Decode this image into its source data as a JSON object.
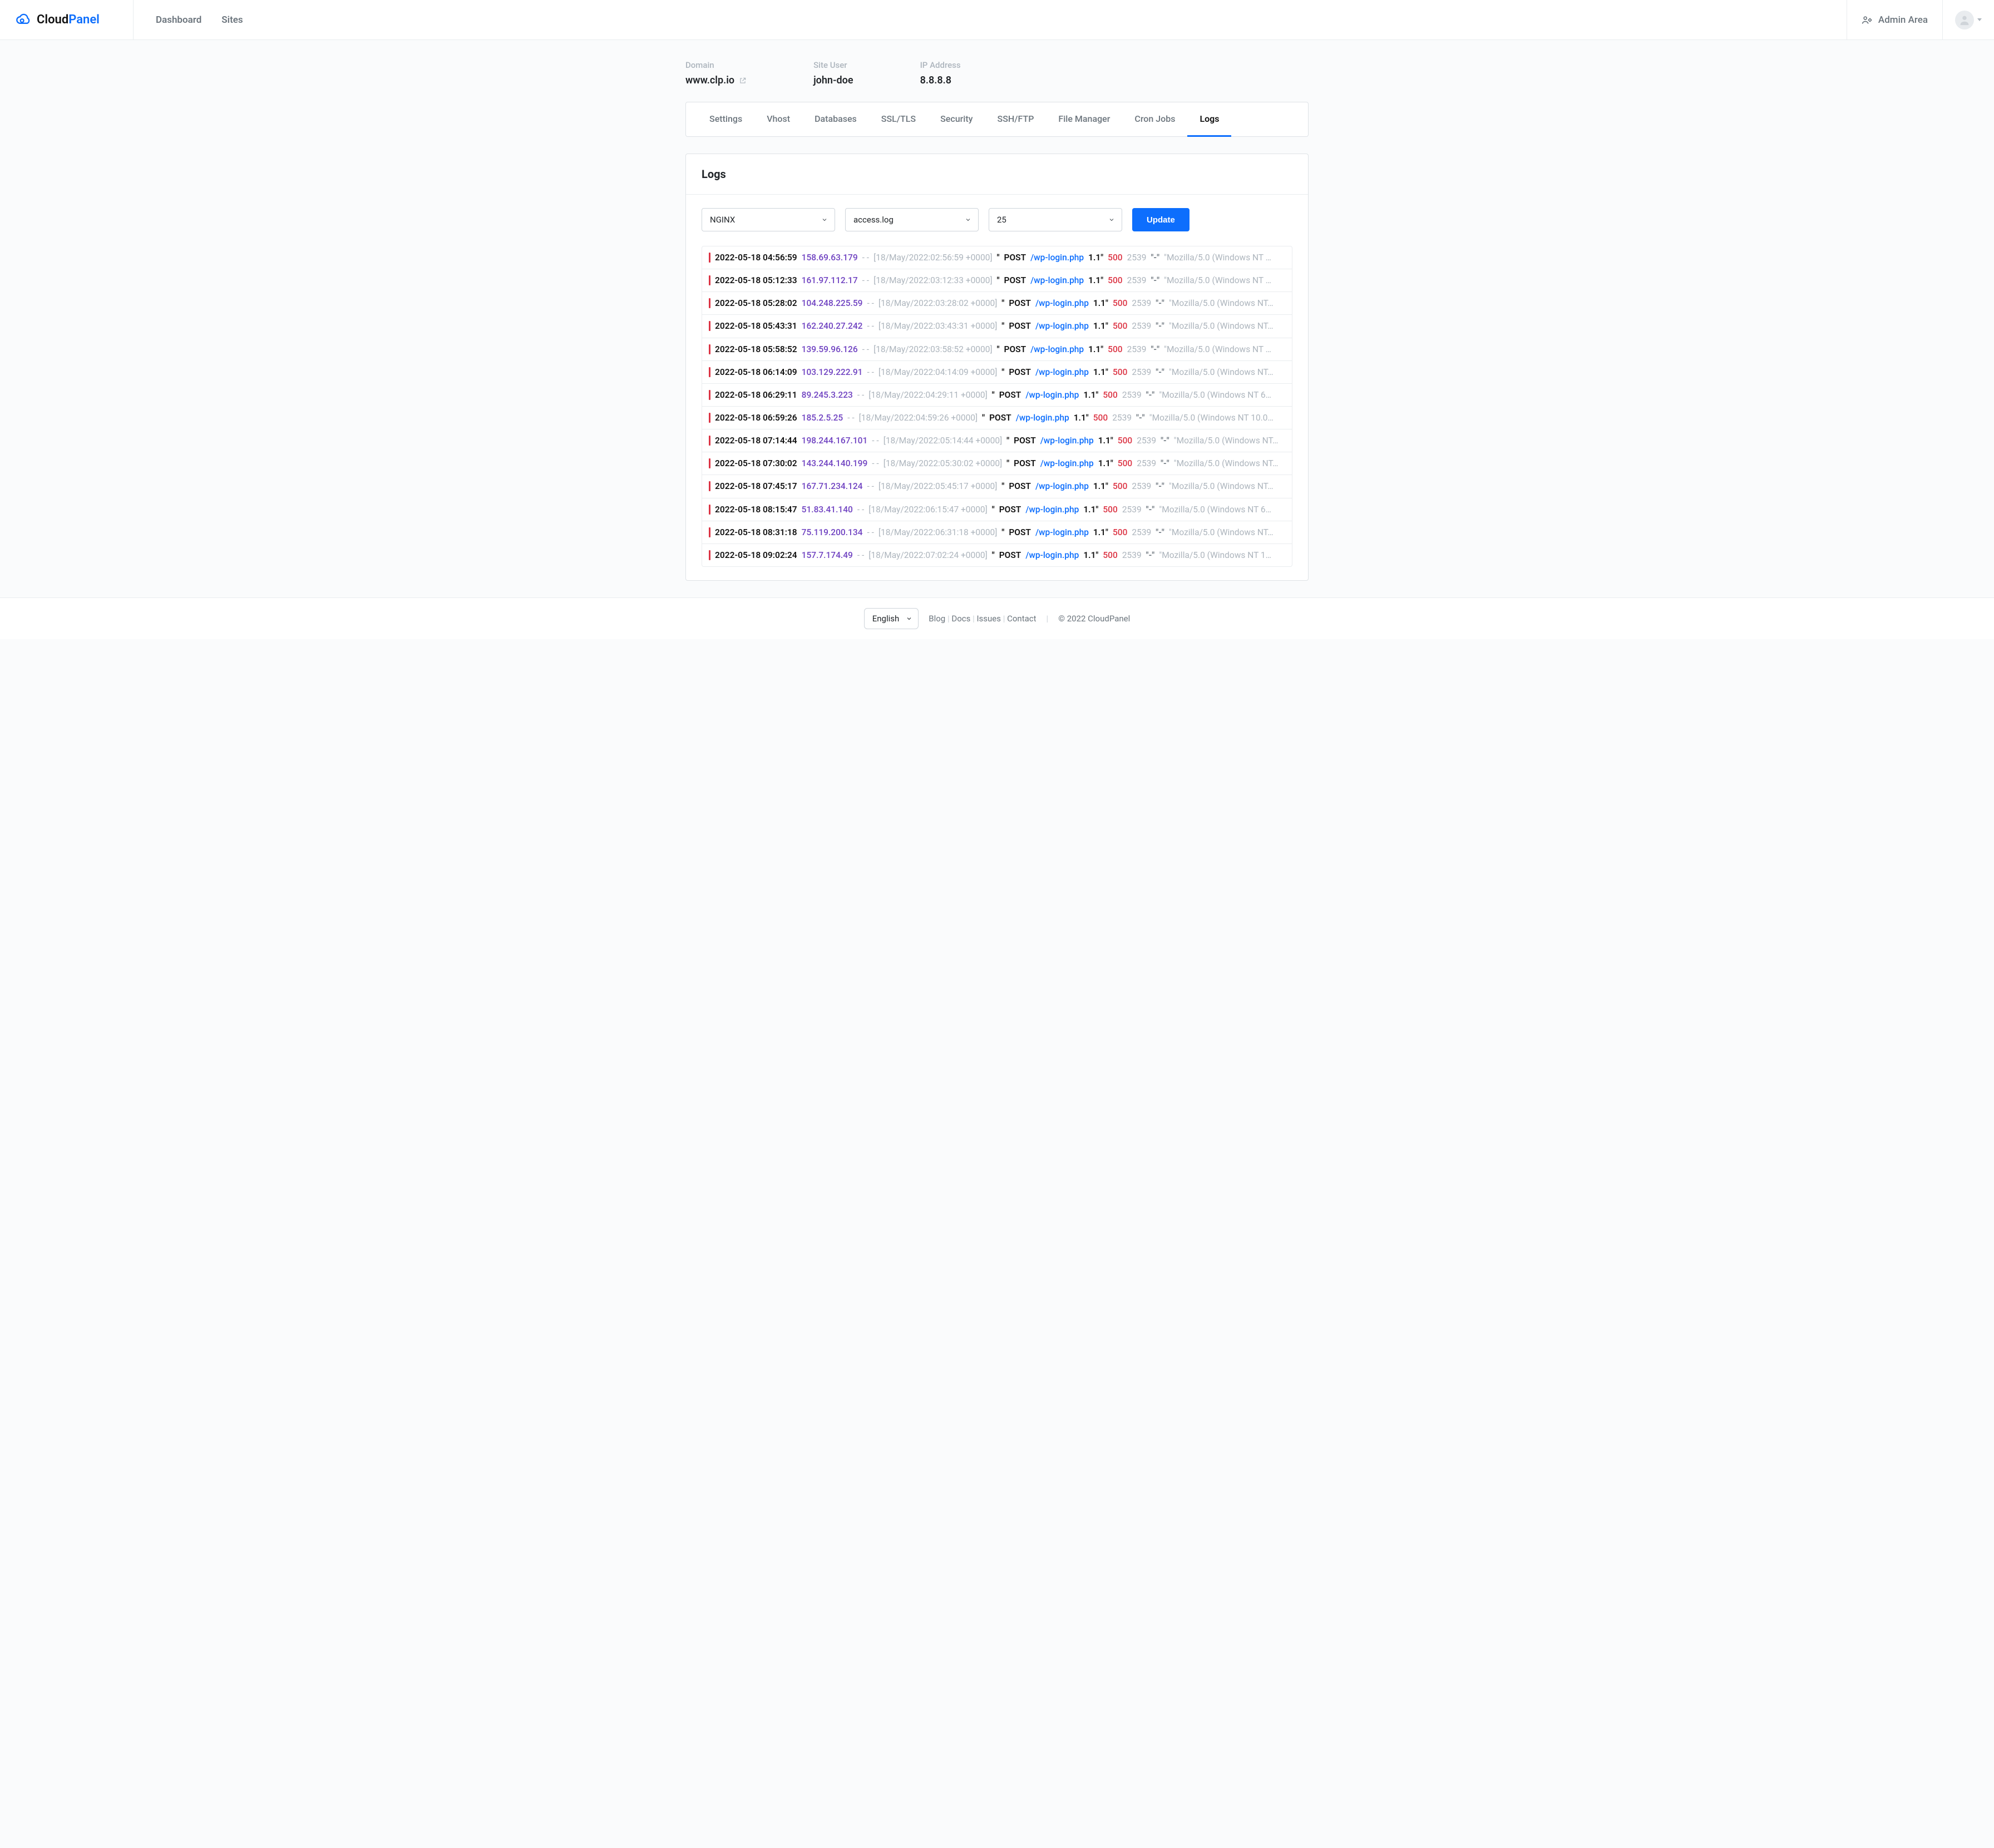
{
  "brand": {
    "part1": "Cloud",
    "part2": "Panel"
  },
  "topnav": {
    "dashboard": "Dashboard",
    "sites": "Sites"
  },
  "admin_area": "Admin Area",
  "meta": {
    "domain_label": "Domain",
    "domain_value": "www.clp.io",
    "siteuser_label": "Site User",
    "siteuser_value": "john-doe",
    "ip_label": "IP Address",
    "ip_value": "8.8.8.8"
  },
  "tabs": [
    "Settings",
    "Vhost",
    "Databases",
    "SSL/TLS",
    "Security",
    "SSH/FTP",
    "File Manager",
    "Cron Jobs",
    "Logs"
  ],
  "active_tab_index": 8,
  "logs_title": "Logs",
  "selects": {
    "service": "NGINX",
    "file": "access.log",
    "count": "25"
  },
  "update_label": "Update",
  "log_template": {
    "dashes": "- -",
    "method_prefix": "\"",
    "method": "POST",
    "path_text": "/wp-login.php",
    "proto": "1.1\"",
    "status": "500",
    "size": "2539",
    "ref": "\"-\"",
    "ua_prefix": "\"Mozilla/5.0 (Windows NT"
  },
  "logs": [
    {
      "ts": "2022-05-18 04:56:59",
      "ip": "158.69.63.179",
      "raw": "[18/May/2022:02:56:59 +0000]",
      "ua_tail": " …"
    },
    {
      "ts": "2022-05-18 05:12:33",
      "ip": "161.97.112.17",
      "raw": "[18/May/2022:03:12:33 +0000]",
      "ua_tail": " …"
    },
    {
      "ts": "2022-05-18 05:28:02",
      "ip": "104.248.225.59",
      "raw": "[18/May/2022:03:28:02 +0000]",
      "ua_tail": "…"
    },
    {
      "ts": "2022-05-18 05:43:31",
      "ip": "162.240.27.242",
      "raw": "[18/May/2022:03:43:31 +0000]",
      "ua_tail": "…"
    },
    {
      "ts": "2022-05-18 05:58:52",
      "ip": "139.59.96.126",
      "raw": "[18/May/2022:03:58:52 +0000]",
      "ua_tail": " …"
    },
    {
      "ts": "2022-05-18 06:14:09",
      "ip": "103.129.222.91",
      "raw": "[18/May/2022:04:14:09 +0000]",
      "ua_tail": "…"
    },
    {
      "ts": "2022-05-18 06:29:11",
      "ip": "89.245.3.223",
      "raw": "[18/May/2022:04:29:11 +0000]",
      "ua_tail": " 6…"
    },
    {
      "ts": "2022-05-18 06:59:26",
      "ip": "185.2.5.25",
      "raw": "[18/May/2022:04:59:26 +0000]",
      "ua_tail": " 10.0…"
    },
    {
      "ts": "2022-05-18 07:14:44",
      "ip": "198.244.167.101",
      "raw": "[18/May/2022:05:14:44 +0000]",
      "ua_tail": "…"
    },
    {
      "ts": "2022-05-18 07:30:02",
      "ip": "143.244.140.199",
      "raw": "[18/May/2022:05:30:02 +0000]",
      "ua_tail": "…"
    },
    {
      "ts": "2022-05-18 07:45:17",
      "ip": "167.71.234.124",
      "raw": "[18/May/2022:05:45:17 +0000]",
      "ua_tail": "…"
    },
    {
      "ts": "2022-05-18 08:15:47",
      "ip": "51.83.41.140",
      "raw": "[18/May/2022:06:15:47 +0000]",
      "ua_tail": " 6…"
    },
    {
      "ts": "2022-05-18 08:31:18",
      "ip": "75.119.200.134",
      "raw": "[18/May/2022:06:31:18 +0000]",
      "ua_tail": "…"
    },
    {
      "ts": "2022-05-18 09:02:24",
      "ip": "157.7.174.49",
      "raw": "[18/May/2022:07:02:24 +0000]",
      "ua_tail": " 1…"
    }
  ],
  "footer": {
    "language": "English",
    "links": [
      "Blog",
      "Docs",
      "Issues",
      "Contact"
    ],
    "copyright": "© 2022   CloudPanel"
  }
}
